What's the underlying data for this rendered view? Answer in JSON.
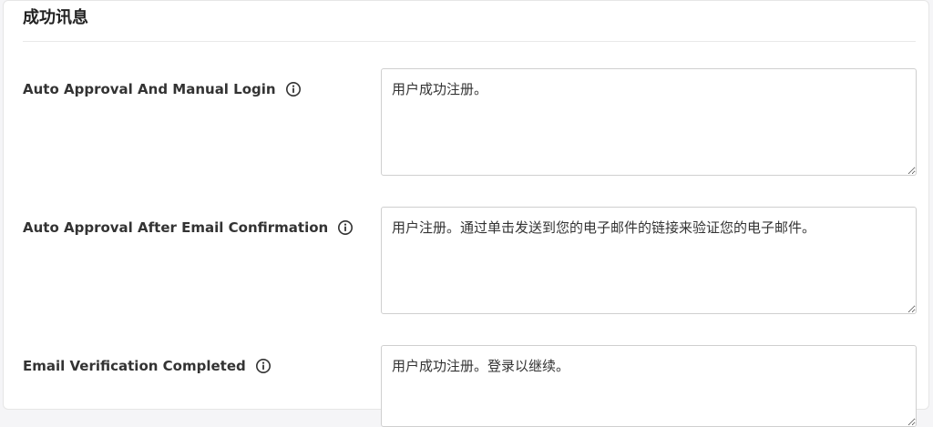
{
  "section": {
    "title": "成功讯息"
  },
  "fields": [
    {
      "label": "Auto Approval And Manual Login",
      "value": "用户成功注册。"
    },
    {
      "label": "Auto Approval After Email Confirmation",
      "value": "用户注册。通过单击发送到您的电子邮件的链接来验证您的电子邮件。"
    },
    {
      "label": "Email Verification Completed",
      "value": "用户成功注册。登录以继续。"
    }
  ],
  "icons": {
    "info": "info-circle-icon"
  }
}
